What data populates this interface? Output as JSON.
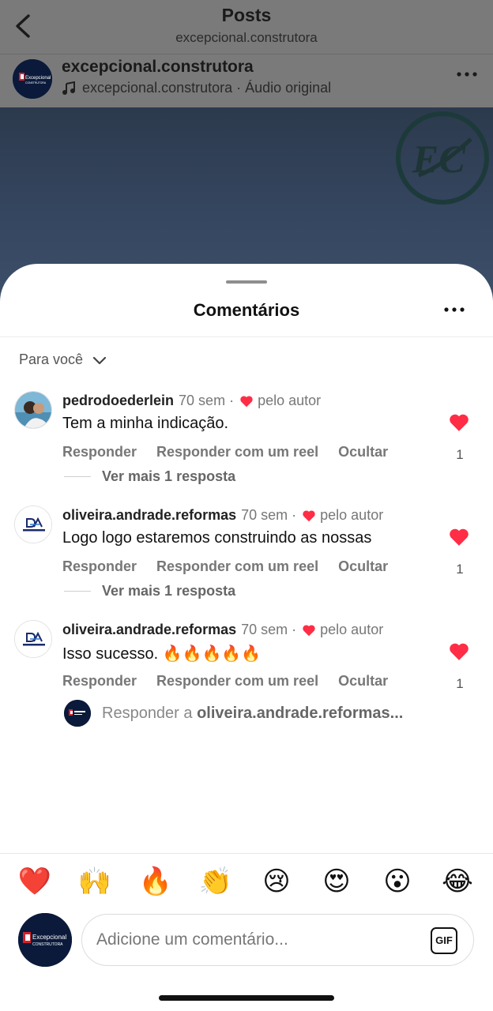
{
  "header": {
    "title": "Posts",
    "subtitle": "excepcional.construtora"
  },
  "post": {
    "author": "excepcional.construtora",
    "audio": "excepcional.construtora · Áudio original",
    "avatar_text": "Excepcional",
    "avatar_subtext": "CONSTRUTORA"
  },
  "sheet": {
    "title": "Comentários",
    "sort_label": "Para você"
  },
  "comments": [
    {
      "user": "pedrodoederlein",
      "time": "70 sem",
      "liked_by_author": "pelo autor",
      "text": "Tem a minha indicação.",
      "actions": [
        "Responder",
        "Responder com um reel",
        "Ocultar"
      ],
      "likes": "1",
      "more_replies": "Ver mais 1 resposta"
    },
    {
      "user": "oliveira.andrade.reformas",
      "time": "70 sem",
      "liked_by_author": "pelo autor",
      "text": "Logo logo estaremos construindo as nossas",
      "actions": [
        "Responder",
        "Responder com um reel",
        "Ocultar"
      ],
      "likes": "1",
      "more_replies": "Ver mais 1 resposta"
    },
    {
      "user": "oliveira.andrade.reformas",
      "time": "70 sem",
      "liked_by_author": "pelo autor",
      "text": "Isso sucesso. 🔥🔥🔥🔥🔥",
      "actions": [
        "Responder",
        "Responder com um reel",
        "Ocultar"
      ],
      "likes": "1"
    }
  ],
  "reply": {
    "prefix": "Responder a ",
    "target": "oliveira.andrade.reformas..."
  },
  "emojis": [
    "❤️",
    "🙌",
    "🔥",
    "👏",
    "😢",
    "😍",
    "😮",
    "😂"
  ],
  "composer": {
    "placeholder": "Adicione um comentário...",
    "gif_label": "GIF"
  },
  "colors": {
    "like_red": "#ff2d45",
    "brand_navy": "#0b1a3b",
    "brand_red": "#d8202a"
  }
}
